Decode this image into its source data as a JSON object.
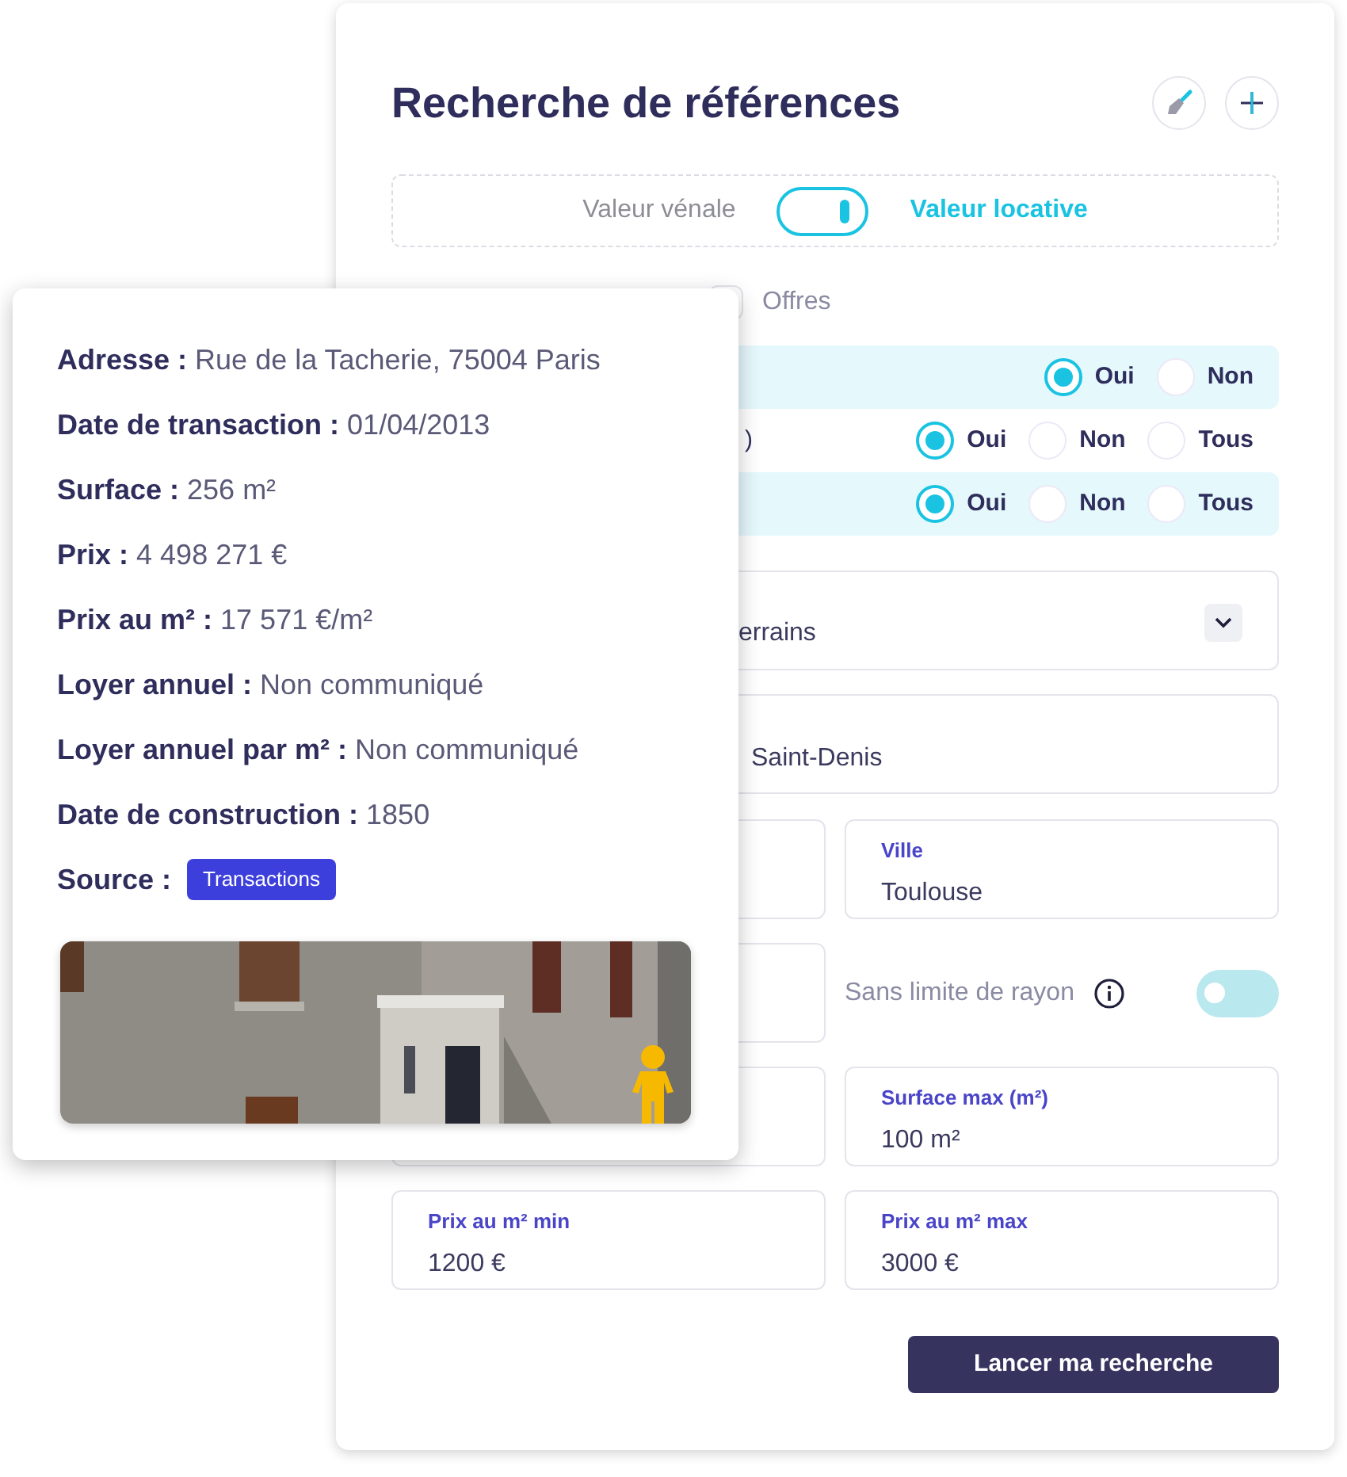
{
  "title": "Recherche de références",
  "value_toggle": {
    "left": "Valeur vénale",
    "right": "Valeur locative",
    "on": true
  },
  "checkboxes": [
    {
      "label": "Offres",
      "checked": false
    }
  ],
  "radio_rows": [
    {
      "highlighted": true,
      "options": [
        {
          "label": "Oui",
          "selected": true
        },
        {
          "label": "Non",
          "selected": false
        }
      ]
    },
    {
      "highlighted": false,
      "label": ")",
      "options": [
        {
          "label": "Oui",
          "selected": true
        },
        {
          "label": "Non",
          "selected": false
        },
        {
          "label": "Tous",
          "selected": false
        }
      ]
    },
    {
      "highlighted": true,
      "options": [
        {
          "label": "Oui",
          "selected": true
        },
        {
          "label": "Non",
          "selected": false
        },
        {
          "label": "Tous",
          "selected": false
        }
      ]
    }
  ],
  "select": {
    "value": "errains"
  },
  "address": {
    "value": "Saint-Denis"
  },
  "grid": [
    {
      "left": {
        "kind": "covered"
      },
      "right": {
        "kind": "field",
        "label": "Ville",
        "value": "Toulouse"
      }
    },
    {
      "left": {
        "kind": "covered"
      },
      "right": {
        "kind": "switch",
        "label": "Sans limite de rayon",
        "on": false
      }
    },
    {
      "left": {
        "kind": "covered"
      },
      "right": {
        "kind": "field",
        "label": "Surface max (m²)",
        "value": "100 m²"
      }
    },
    {
      "left": {
        "kind": "field",
        "label": "Prix au m² min",
        "value": "1200 €"
      },
      "right": {
        "kind": "field",
        "label": "Prix au m² max",
        "value": "3000 €"
      }
    }
  ],
  "submit": "Lancer ma recherche",
  "popup": {
    "rows": [
      "**Adresse :** Rue de la Tacherie, 75004 Paris",
      "**Date de transaction :** 01/04/2013",
      "**Surface :** 256 m²",
      "**Prix :** 4 498 271 €",
      "**Prix au m² :** 17 571 €/m²",
      "**Loyer annuel :** Non communiqué",
      "**Loyer annuel par m² :** Non communiqué",
      "**Date de construction :** 1850"
    ],
    "source": {
      "label": "Source :",
      "badge": "Transactions"
    }
  }
}
